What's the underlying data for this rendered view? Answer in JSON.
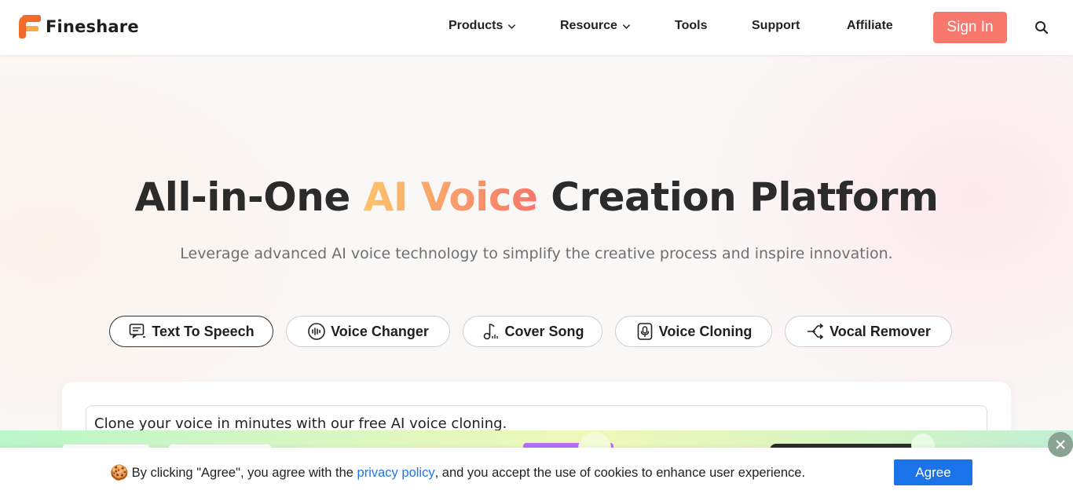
{
  "brand": {
    "name": "Fineshare"
  },
  "nav": {
    "items": [
      {
        "label": "Products",
        "dropdown": true
      },
      {
        "label": "Resource",
        "dropdown": true
      },
      {
        "label": "Tools",
        "dropdown": false
      },
      {
        "label": "Support",
        "dropdown": false
      },
      {
        "label": "Affiliate",
        "dropdown": false
      }
    ],
    "sign_in": "Sign In",
    "search_icon": "search-icon"
  },
  "hero": {
    "title_part1": "All-in-One ",
    "title_accent": "AI Voice",
    "title_part2": " Creation Platform",
    "subtitle": "Leverage advanced AI voice technology to simplify the creative process and inspire innovation."
  },
  "tabs": [
    {
      "label": "Text To Speech",
      "icon": "text-to-speech-icon",
      "active": true
    },
    {
      "label": "Voice Changer",
      "icon": "voice-changer-icon",
      "active": false
    },
    {
      "label": "Cover Song",
      "icon": "music-note-icon",
      "active": false
    },
    {
      "label": "Voice Cloning",
      "icon": "microphone-icon",
      "active": false
    },
    {
      "label": "Vocal Remover",
      "icon": "split-arrow-icon",
      "active": false
    }
  ],
  "editor": {
    "text": "Clone your voice in minutes with our free AI voice cloning."
  },
  "cookie": {
    "emoji": "🍪",
    "text_before": "By clicking \"Agree\", you agree with the ",
    "link": "privacy policy",
    "text_after": ", and you accept the use of cookies to enhance user experience.",
    "agree": "Agree"
  },
  "colors": {
    "accent_start": "#fbc46b",
    "accent_end": "#f5776a",
    "sign_in_bg": "#f8786d",
    "agree_bg": "#1a73e8",
    "link": "#1f76e8"
  }
}
